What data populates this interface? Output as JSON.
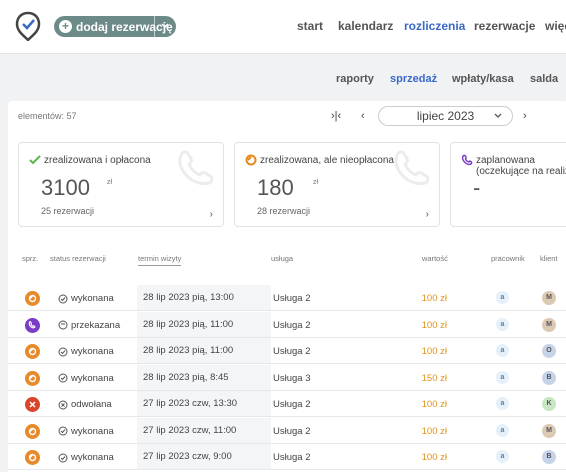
{
  "header": {
    "add_label": "dodaj rezerwację",
    "nav": [
      {
        "label": "start"
      },
      {
        "label": "kalendarz"
      },
      {
        "label": "rozliczenia"
      },
      {
        "label": "rezerwacje"
      },
      {
        "label": "więc"
      }
    ],
    "active_nav": "rozliczenia"
  },
  "subnav": [
    {
      "label": "raporty"
    },
    {
      "label": "sprzedaż"
    },
    {
      "label": "wpłaty/kasa"
    },
    {
      "label": "salda"
    }
  ],
  "active_subnav": "sprzedaż",
  "toolbar": {
    "count_label": "elementów: 57",
    "month": "lipiec 2023"
  },
  "cards": [
    {
      "title": "zrealizowana i opłacona",
      "amount": "3100",
      "currency": "zł",
      "sub": "25 rezerwacji",
      "color": "#5ab54a"
    },
    {
      "title": "zrealizowana, ale nieopłacona",
      "amount": "180",
      "currency": "zł",
      "sub": "28 rezerwacji",
      "color": "#e48b1c"
    },
    {
      "title": "zaplanowana (oczekujące na realiza",
      "amount": "-",
      "currency": "",
      "sub": "",
      "color": "#7b3bc9"
    }
  ],
  "table": {
    "headers": [
      "sprz.",
      "status rezerwacji",
      "termin wizyty",
      "usługa",
      "wartość",
      "pracownik",
      "klient"
    ],
    "rows": [
      {
        "status": "wykonana",
        "status_icon": "check-circle-icon",
        "date": "28 lip 2023 pią, 13:00",
        "service": "Usługa 2",
        "value": "100 zł",
        "employee": "a",
        "client": "M",
        "client_color": "#dcc9b4",
        "badge_color": "#e8892a",
        "badge_icon": "paid-partial-icon"
      },
      {
        "status": "przekazana",
        "status_icon": "clock-circle-icon",
        "date": "28 lip 2023 pią, 11:00",
        "service": "Usługa 2",
        "value": "100 zł",
        "employee": "a",
        "client": "M",
        "client_color": "#dcc9b4",
        "badge_color": "#7b3bc9",
        "badge_icon": "phone-icon"
      },
      {
        "status": "wykonana",
        "status_icon": "check-circle-icon",
        "date": "28 lip 2023 pią, 11:00",
        "service": "Usługa 2",
        "value": "100 zł",
        "employee": "a",
        "client": "O",
        "client_color": "#c7d3e8",
        "badge_color": "#e8892a",
        "badge_icon": "paid-partial-icon"
      },
      {
        "status": "wykonana",
        "status_icon": "check-circle-icon",
        "date": "28 lip 2023 pią, 8:45",
        "service": "Usługa 3",
        "value": "150 zł",
        "employee": "a",
        "client": "B",
        "client_color": "#c7d3e8",
        "badge_color": "#e8892a",
        "badge_icon": "paid-partial-icon"
      },
      {
        "status": "odwołana",
        "status_icon": "x-circle-icon",
        "date": "27 lip 2023 czw, 13:30",
        "service": "Usługa 2",
        "value": "100 zł",
        "employee": "a",
        "client": "K",
        "client_color": "#c9e6c4",
        "badge_color": "#d9452a",
        "badge_icon": "cancel-icon"
      },
      {
        "status": "wykonana",
        "status_icon": "check-circle-icon",
        "date": "27 lip 2023 czw, 11:00",
        "service": "Usługa 2",
        "value": "100 zł",
        "employee": "a",
        "client": "M",
        "client_color": "#dcc9b4",
        "badge_color": "#e8892a",
        "badge_icon": "paid-partial-icon"
      },
      {
        "status": "wykonana",
        "status_icon": "check-circle-icon",
        "date": "27 lip 2023 czw, 9:00",
        "service": "Usługa 2",
        "value": "100 zł",
        "employee": "a",
        "client": "B",
        "client_color": "#c7d3e8",
        "badge_color": "#e8892a",
        "badge_icon": "paid-partial-icon"
      }
    ]
  }
}
